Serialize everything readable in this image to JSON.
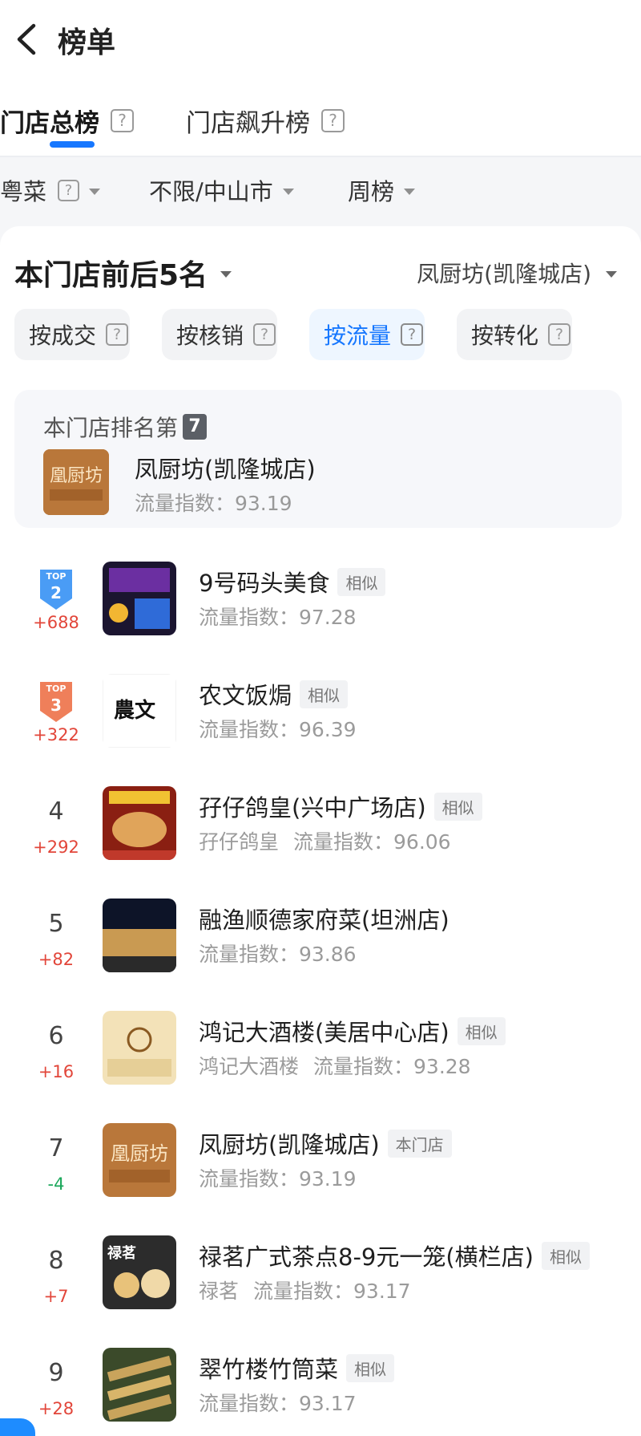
{
  "header": {
    "back_icon": "chevron-left-icon",
    "title": "榜单"
  },
  "tabs": [
    {
      "label": "门店总榜",
      "help": "?",
      "active": true
    },
    {
      "label": "门店飙升榜",
      "help": "?",
      "active": false
    }
  ],
  "filters": {
    "cuisine": "粤菜",
    "cuisine_help": "?",
    "region": "不限/中山市",
    "period": "周榜"
  },
  "neighbors": {
    "title": "本门店前后5名",
    "store_select": "凤厨坊(凯隆城店)",
    "sort_options": [
      {
        "label": "按成交",
        "help": "?",
        "active": false
      },
      {
        "label": "按核销",
        "help": "?",
        "active": false
      },
      {
        "label": "按流量",
        "help": "?",
        "active": true
      },
      {
        "label": "按转化",
        "help": "?",
        "active": false
      }
    ]
  },
  "my_store": {
    "rank_label": "本门店排名第",
    "rank": "7",
    "name": "凤厨坊(凯隆城店)",
    "metric": "流量指数：93.19",
    "logo_text": "凰厨坊"
  },
  "rows": [
    {
      "rank": "TOP 2",
      "badge": "2",
      "badge_color": "#4a9cf5",
      "change": "+688",
      "name": "9号码头美食",
      "tag": "相似",
      "brand": "",
      "metric": "流量指数：97.28"
    },
    {
      "rank": "TOP 3",
      "badge": "3",
      "badge_color": "#ef7f5a",
      "change": "+322",
      "name": "农文饭焗",
      "tag": "相似",
      "brand": "",
      "metric": "流量指数：96.39",
      "logo_text": "農文"
    },
    {
      "rank": "4",
      "change": "+292",
      "name": "孖仔鸽皇(兴中广场店)",
      "tag": "相似",
      "brand": "孖仔鸽皇",
      "metric": "流量指数：96.06"
    },
    {
      "rank": "5",
      "change": "+82",
      "name": "融渔顺德家府菜(坦洲店)",
      "tag": "",
      "brand": "",
      "metric": "流量指数：93.86"
    },
    {
      "rank": "6",
      "change": "+16",
      "name": "鸿记大酒楼(美居中心店)",
      "tag": "相似",
      "brand": "鸿记大酒楼",
      "metric": "流量指数：93.28"
    },
    {
      "rank": "7",
      "change": "-4",
      "name": "凤厨坊(凯隆城店)",
      "tag": "本门店",
      "brand": "",
      "metric": "流量指数：93.19",
      "logo_text": "凰厨坊"
    },
    {
      "rank": "8",
      "change": "+7",
      "name": "禄茗广式茶点8-9元一笼(横栏店)",
      "tag": "相似",
      "brand": "禄茗",
      "metric": "流量指数：93.17",
      "logo_text": "禄茗"
    },
    {
      "rank": "9",
      "change": "+28",
      "name": "翠竹楼竹筒菜",
      "tag": "相似",
      "brand": "",
      "metric": "流量指数：93.17"
    }
  ],
  "colors": {
    "accent": "#1677ff",
    "up": "#e2463a",
    "down": "#1aa75a"
  }
}
